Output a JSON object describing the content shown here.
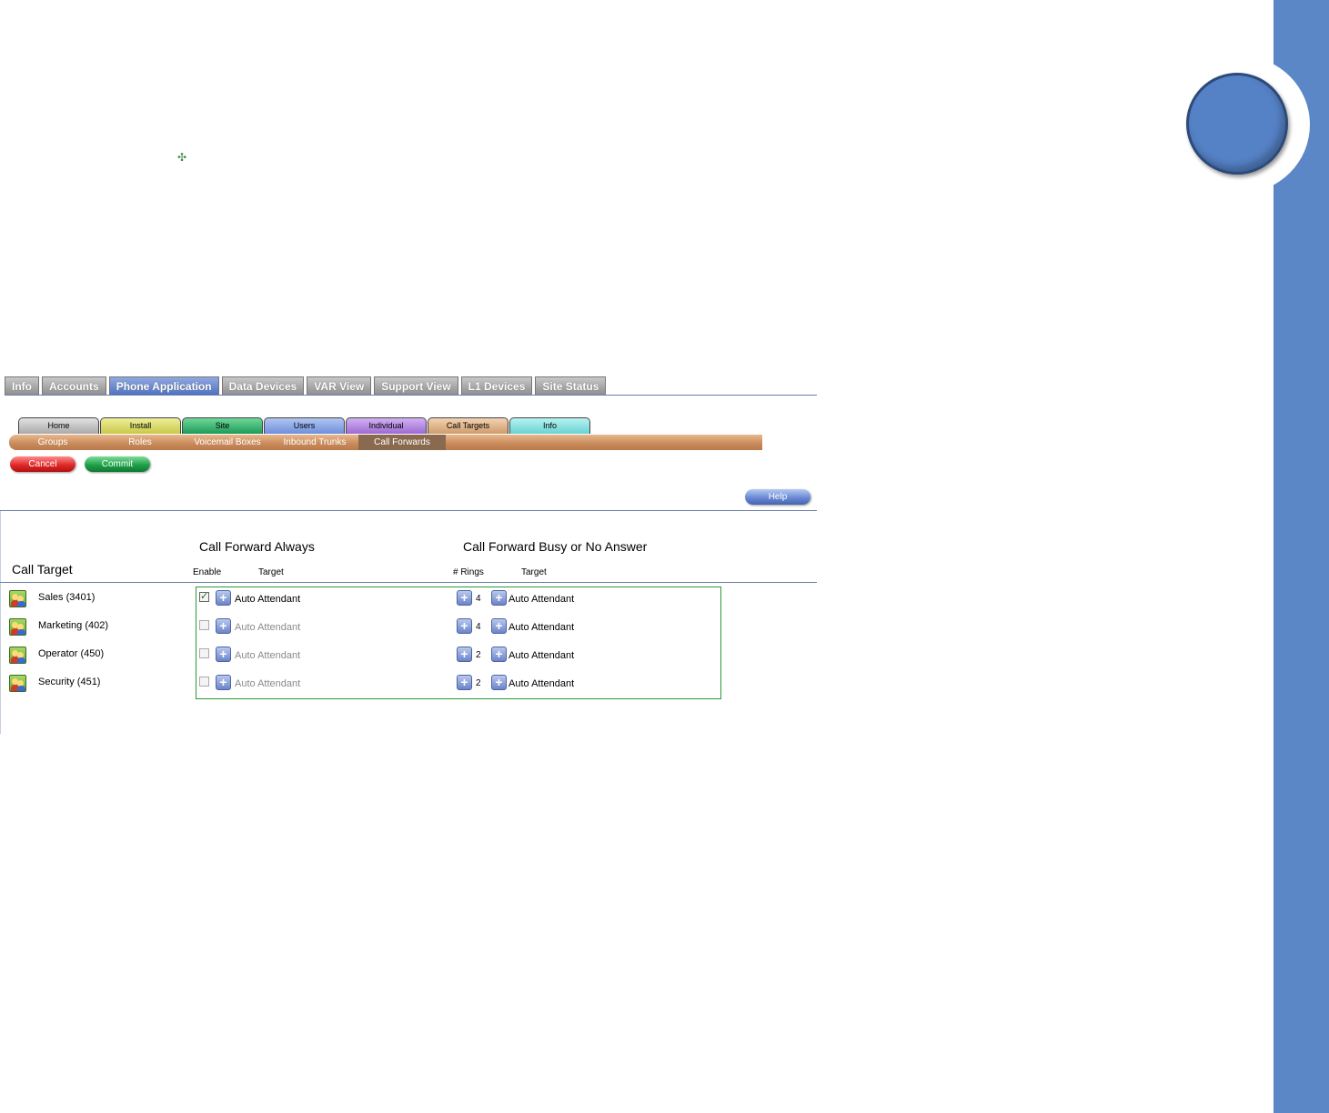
{
  "top_tabs": [
    {
      "label": "Info",
      "active": false
    },
    {
      "label": "Accounts",
      "active": false
    },
    {
      "label": "Phone Application",
      "active": true
    },
    {
      "label": "Data Devices",
      "active": false
    },
    {
      "label": "VAR View",
      "active": false
    },
    {
      "label": "Support View",
      "active": false
    },
    {
      "label": "L1 Devices",
      "active": false
    },
    {
      "label": "Site Status",
      "active": false
    }
  ],
  "category_tabs": [
    {
      "label": "Home",
      "color": "#c9c9c9"
    },
    {
      "label": "Install",
      "color": "#d8d86a"
    },
    {
      "label": "Site",
      "color": "#3cb878"
    },
    {
      "label": "Users",
      "color": "#8aa6e8"
    },
    {
      "label": "Individual",
      "color": "#b58ae0"
    },
    {
      "label": "Call Targets",
      "color": "#e0b48e"
    },
    {
      "label": "Info",
      "color": "#8ee0e0"
    }
  ],
  "sub_tabs": [
    {
      "label": "Groups",
      "active": false
    },
    {
      "label": "Roles",
      "active": false
    },
    {
      "label": "Voicemail Boxes",
      "active": false
    },
    {
      "label": "Inbound Trunks",
      "active": false
    },
    {
      "label": "Call Forwards",
      "active": true
    }
  ],
  "buttons": {
    "cancel": "Cancel",
    "commit": "Commit",
    "help": "Help"
  },
  "table": {
    "call_target_heading": "Call Target",
    "cf_always_heading": "Call Forward Always",
    "cf_busy_heading": "Call Forward Busy or No Answer",
    "col_enable": "Enable",
    "col_target": "Target",
    "col_rings": "# Rings",
    "col_target2": "Target",
    "rows": [
      {
        "name": "Sales (3401)",
        "enabled": true,
        "always_target": "Auto Attendant",
        "rings": "4",
        "busy_target": "Auto Attendant"
      },
      {
        "name": "Marketing (402)",
        "enabled": false,
        "always_target": "Auto Attendant",
        "rings": "4",
        "busy_target": "Auto Attendant"
      },
      {
        "name": "Operator (450)",
        "enabled": false,
        "always_target": "Auto Attendant",
        "rings": "2",
        "busy_target": "Auto Attendant"
      },
      {
        "name": "Security (451)",
        "enabled": false,
        "always_target": "Auto Attendant",
        "rings": "2",
        "busy_target": "Auto Attendant"
      }
    ]
  },
  "colors": {
    "side_band": "#5b87c7",
    "rule": "#6a7fa8",
    "box_border": "#2a9a3a"
  },
  "icons": [
    "move-icon",
    "group-icon",
    "plus-icon",
    "checkmark-icon"
  ]
}
